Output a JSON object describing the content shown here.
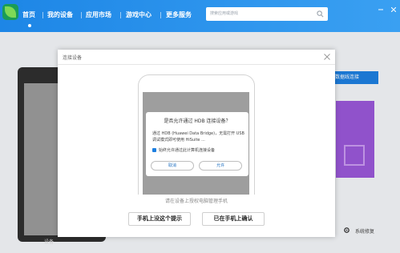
{
  "nav": {
    "items": [
      "首页",
      "我的设备",
      "应用市场",
      "游戏中心",
      "更多服务"
    ],
    "active_index": 0
  },
  "search": {
    "placeholder": "搜索应用或游戏"
  },
  "background": {
    "device_label": "设备",
    "blue_button_label": "数据线连接",
    "settings_label": "系统修复"
  },
  "dialog": {
    "title": "连接设备",
    "alert": {
      "title": "是否允许通过 HDB 连接设备？",
      "body": "通过 HDB (Huawei Data Bridge)，无需打开 USB 调试模式即可使用 HiSuite ...",
      "checkbox_label": "始终允许通过此计算机连接设备",
      "cancel_label": "取消",
      "allow_label": "允许"
    },
    "hint": "请在设备上授权电脑管理手机",
    "ignore_button": "手机上没这个提示",
    "confirm_button": "已在手机上确认"
  },
  "colors": {
    "topbar": "#2b94ec",
    "accent": "#1d7fe0",
    "purple_tile": "#9a58d8"
  },
  "icons": [
    "logo-icon",
    "search-icon",
    "minimize-icon",
    "close-icon",
    "gear-icon",
    "checkbox-icon"
  ]
}
